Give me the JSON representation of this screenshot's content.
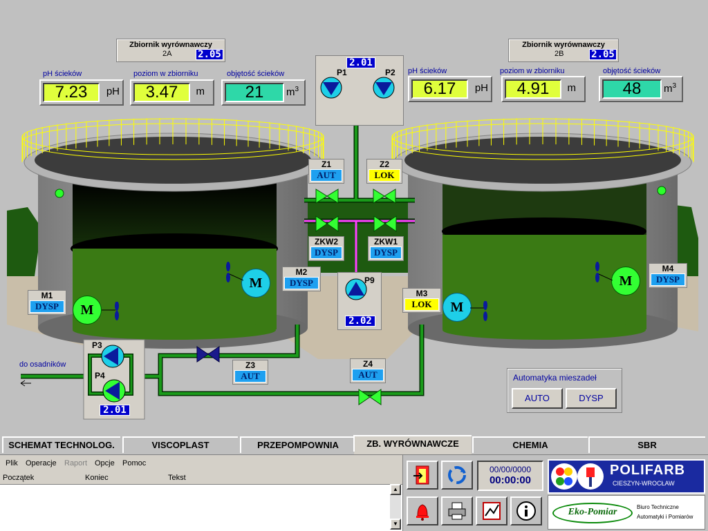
{
  "tank_a": {
    "title": "Zbiornik wyrównawczy",
    "sub": "2A",
    "code": "2.05",
    "ph_label": "pH ścieków",
    "ph_value": "7.23",
    "ph_unit": "pH",
    "level_label": "poziom w zbiorniku",
    "level_value": "3.47",
    "level_unit": "m",
    "volume_label": "objętość ścieków",
    "volume_value": "21",
    "volume_unit": "m",
    "volume_exp": "3"
  },
  "tank_b": {
    "title": "Zbiornik wyrównawczy",
    "sub": "2B",
    "code": "2.05",
    "ph_label": "pH ścieków",
    "ph_value": "6.17",
    "ph_unit": "pH",
    "level_label": "poziom w zbiorniku",
    "level_value": "4.91",
    "level_unit": "m",
    "volume_label": "objętość ścieków",
    "volume_value": "48",
    "volume_unit": "m",
    "volume_exp": "3"
  },
  "pumps": {
    "p1": "P1",
    "p2": "P2",
    "p12_code": "2.01",
    "p9": "P9",
    "p9_code": "2.02",
    "p3": "P3",
    "p4": "P4",
    "p34_code": "2.01"
  },
  "valves": {
    "z1": {
      "name": "Z1",
      "state": "AUT"
    },
    "z2": {
      "name": "Z2",
      "state": "LOK"
    },
    "zkw2": {
      "name": "ZKW2",
      "state": "DYSP"
    },
    "zkw1": {
      "name": "ZKW1",
      "state": "DYSP"
    },
    "z3": {
      "name": "Z3",
      "state": "AUT"
    },
    "z4": {
      "name": "Z4",
      "state": "AUT"
    }
  },
  "mixers": {
    "m1": {
      "name": "M1",
      "state": "DYSP"
    },
    "m2": {
      "name": "M2",
      "state": "DYSP"
    },
    "m3": {
      "name": "M3",
      "state": "LOK"
    },
    "m4": {
      "name": "M4",
      "state": "DYSP"
    },
    "motor_letter": "M"
  },
  "outlet_label": "do osadników",
  "auto_panel": {
    "title": "Automatyka mieszadeł",
    "auto": "AUTO",
    "dysp": "DYSP"
  },
  "tabs": [
    {
      "label": "SCHEMAT TECHNOLOG."
    },
    {
      "label": "VISCOPLAST"
    },
    {
      "label": "PRZEPOMPOWNIA"
    },
    {
      "label": "ZB. WYRÓWNAWCZE"
    },
    {
      "label": "CHEMIA"
    },
    {
      "label": "SBR"
    }
  ],
  "menu": [
    "Plik",
    "Operacje",
    "Raport",
    "Opcje",
    "Pomoc"
  ],
  "log_headers": [
    "Początek",
    "Koniec",
    "Tekst"
  ],
  "clock": {
    "date": "00/00/0000",
    "time": "00:00:00"
  },
  "logo": {
    "brand": "POLIFARB",
    "brand_sub": "CIESZYN-WROCŁAW",
    "partner": "Eko-Pomiar",
    "partner_line1": "Biuro Techniczne",
    "partner_line2": "Automatyki i Pomiarów"
  },
  "colors": {
    "liquid": "#2e6a10",
    "pipe": "#0a6e0a",
    "status_blue": "#1ea0f0",
    "status_yellow": "#ffff00",
    "valve_green": "#33ff33",
    "valve_blue": "#1a1a8c"
  }
}
